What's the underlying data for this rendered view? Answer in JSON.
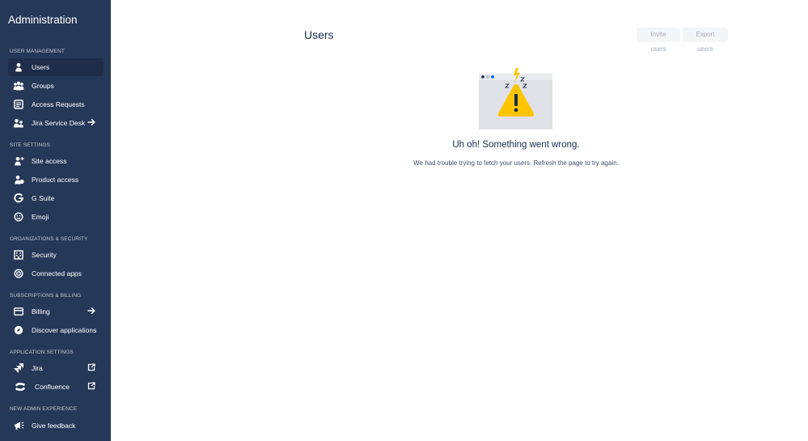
{
  "sidebar": {
    "title": "Administration",
    "sections": [
      {
        "header": "USER MANAGEMENT",
        "items": [
          {
            "label": "Users",
            "icon": "person-icon",
            "selected": true
          },
          {
            "label": "Groups",
            "icon": "people-group-icon"
          },
          {
            "label": "Access Requests",
            "icon": "document-list-icon"
          },
          {
            "label": "Jira Service Desk",
            "icon": "people-icon",
            "trail": "arrow-right-icon"
          }
        ]
      },
      {
        "header": "SITE SETTINGS",
        "items": [
          {
            "label": "Site access",
            "icon": "person-add-icon"
          },
          {
            "label": "Product access",
            "icon": "person-check-icon"
          },
          {
            "label": "G Suite",
            "icon": "google-g-icon"
          },
          {
            "label": "Emoji",
            "icon": "emoji-icon"
          }
        ]
      },
      {
        "header": "ORGANIZATIONS & SECURITY",
        "items": [
          {
            "label": "Security",
            "icon": "office-building-icon"
          },
          {
            "label": "Connected apps",
            "icon": "target-icon"
          }
        ]
      },
      {
        "header": "SUBSCRIPTIONS & BILLING",
        "items": [
          {
            "label": "Billing",
            "icon": "credit-card-icon",
            "trail": "arrow-right-icon"
          },
          {
            "label": "Discover applications",
            "icon": "compass-icon"
          }
        ]
      },
      {
        "header": "APPLICATION SETTINGS",
        "items": [
          {
            "label": "Jira",
            "icon": "jira-icon",
            "trail": "external-link-icon"
          },
          {
            "label": "Confluence",
            "icon": "confluence-icon",
            "trail": "external-link-icon"
          }
        ]
      },
      {
        "header": "NEW ADMIN EXPERIENCE",
        "items": [
          {
            "label": "Give feedback",
            "icon": "megaphone-icon"
          }
        ]
      }
    ]
  },
  "main": {
    "title": "Users",
    "invite_label": "Invite users",
    "export_label": "Export users",
    "error": {
      "title": "Uh oh! Something went wrong.",
      "body": "We had trouble trying to fetch your users. Refresh the page to try again."
    }
  },
  "colors": {
    "sidebar_bg": "#253858",
    "selected_bg": "#1d2d4a",
    "warning_yellow": "#ffc400",
    "illustration_bg": "#dfe1e6"
  }
}
